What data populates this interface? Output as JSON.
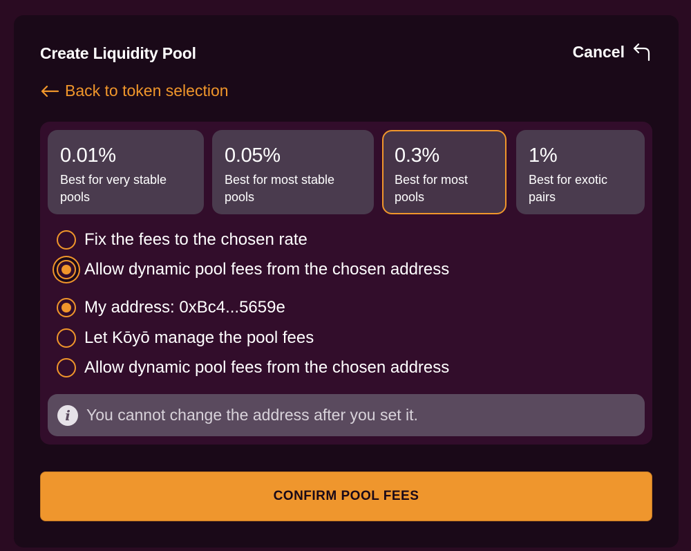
{
  "header": {
    "title": "Create Liquidity Pool",
    "cancel_label": "Cancel"
  },
  "nav": {
    "back_label": "Back to token selection"
  },
  "fee_tiers": [
    {
      "percent": "0.01%",
      "description": "Best for very stable pools",
      "selected": false
    },
    {
      "percent": "0.05%",
      "description": "Best for most stable pools",
      "selected": false
    },
    {
      "percent": "0.3%",
      "description": "Best for most pools",
      "selected": true
    },
    {
      "percent": "1%",
      "description": "Best for exotic pairs",
      "selected": false
    }
  ],
  "fee_mode_options": [
    {
      "label": "Fix the fees to the chosen rate",
      "checked": false
    },
    {
      "label": "Allow dynamic pool fees from the chosen address",
      "checked": true
    }
  ],
  "address_options": [
    {
      "label": "My address: 0xBc4...5659e",
      "checked": true
    },
    {
      "label": "Let Kōyō manage the pool fees",
      "checked": false
    },
    {
      "label": "Allow dynamic pool fees from the chosen address",
      "checked": false
    }
  ],
  "info": {
    "icon": "info-icon",
    "text": "You cannot change the address after you set it."
  },
  "actions": {
    "confirm_label": "CONFIRM POOL FEES"
  },
  "colors": {
    "accent": "#f0962b",
    "background": "#2a0b22",
    "panel": "#1a0918",
    "card": "#4a3b4e"
  }
}
